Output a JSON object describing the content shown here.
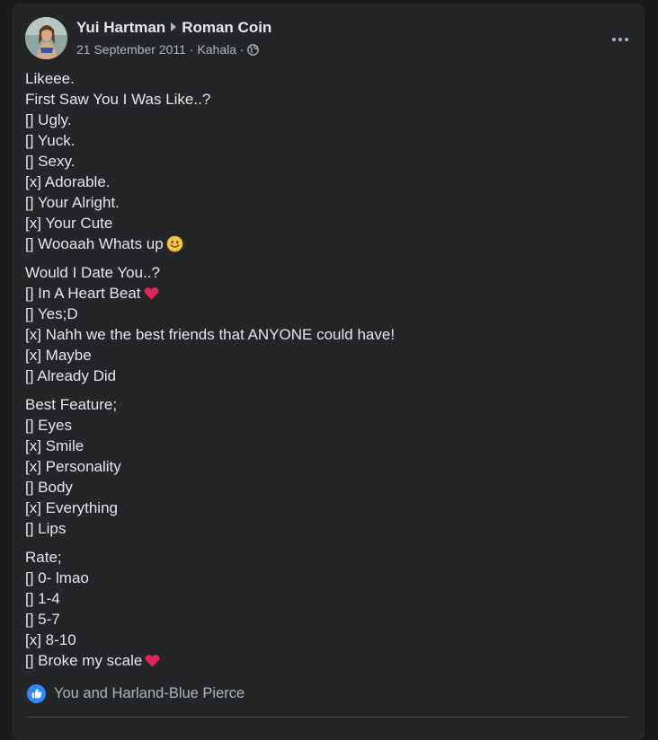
{
  "post": {
    "author": "Yui Hartman",
    "target": "Roman Coin",
    "date": "21 September 2011",
    "location": "Kahala",
    "separator": "·",
    "paragraphs": [
      [
        "Likeee.",
        "First Saw You I Was Like..?",
        "[] Ugly.",
        "[] Yuck.",
        "[] Sexy.",
        "[x] Adorable.",
        "[] Your Alright.",
        "[x] Your Cute",
        "[] Wooaah Whats up"
      ],
      [
        "Would I Date You..?",
        "[] In A Heart Beat",
        "[] Yes;D",
        "[x] Nahh we the best friends that ANYONE could have!",
        "[x] Maybe",
        "[] Already Did"
      ],
      [
        "Best Feature;",
        "[] Eyes",
        "[x] Smile",
        "[x] Personality",
        "[] Body",
        "[x] Everything",
        "[] Lips"
      ],
      [
        "Rate;",
        "[] 0- lmao",
        "[] 1-4",
        "[] 5-7",
        "[x] 8-10",
        "[] Broke my scale"
      ]
    ],
    "reactions_text": "You and Harland-Blue Pierce"
  },
  "icons": {
    "audience": "globe-icon",
    "more": "more-options-icon",
    "reaction": "like-icon",
    "emoji_smile": "smile-emoji-icon",
    "emoji_heart": "heart-emoji-icon"
  },
  "colors": {
    "background": "#18191a",
    "card": "#242526",
    "primary_text": "#e4e6eb",
    "secondary_text": "#b0b3b8",
    "like_blue": "#2e89ff",
    "heart_red": "#e0245e"
  }
}
